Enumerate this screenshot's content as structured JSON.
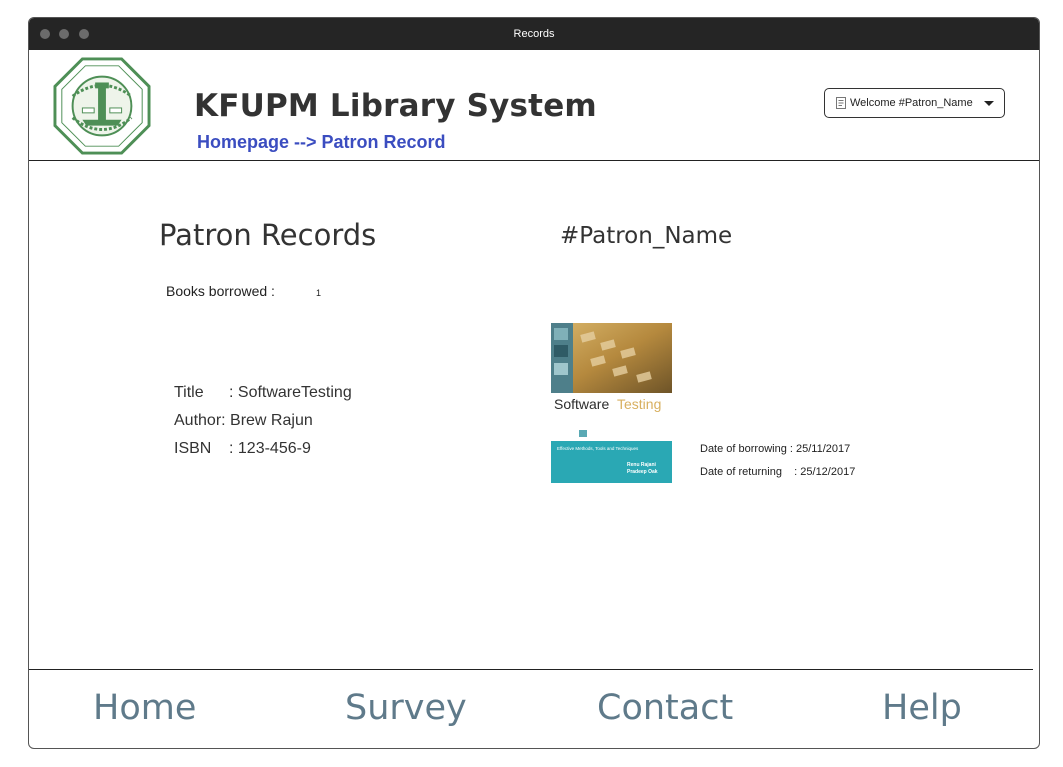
{
  "window": {
    "title": "Records"
  },
  "header": {
    "app_title": "KFUPM Library System",
    "breadcrumb": "Homepage --> Patron Record",
    "user_menu_label": "Welcome #Patron_Name",
    "logo_icon": "kfupm-seal-logo"
  },
  "main": {
    "section_title": "Patron Records",
    "patron_name": "#Patron_Name",
    "books_borrowed_label": "Books borrowed :",
    "books_borrowed_count": "1",
    "book": {
      "title_label": "Title",
      "title_value": ": SoftwareTesting",
      "author_label": "Author",
      "author_value": ": Brew Rajun",
      "isbn_label": "ISBN",
      "isbn_value": ":  123-456-9",
      "cover_title_a": "Software",
      "cover_title_b": "Testing",
      "cover_subtitle": "Effective Methods, Tools and Techniques",
      "cover_author_1": "Renu Rajani",
      "cover_author_2": "Pradeep Oak"
    },
    "date_of_borrowing": "Date of borrowing : 25/11/2017",
    "date_of_returning": "Date of returning    : 25/12/2017"
  },
  "footer": {
    "links": [
      "Home",
      "Survey",
      "Contact",
      "Help"
    ]
  },
  "colors": {
    "titlebar": "#252525",
    "breadcrumb": "#3b4dc0",
    "footer_link": "#5f7a8a",
    "logo_green": "#4e8f56"
  }
}
